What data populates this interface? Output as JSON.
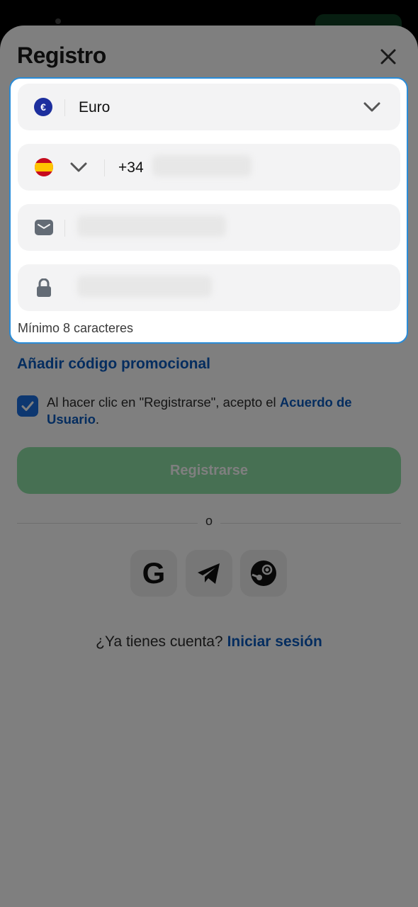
{
  "sheet": {
    "title": "Registro"
  },
  "currency": {
    "symbol": "€",
    "value": "Euro"
  },
  "phone": {
    "code": "+34"
  },
  "password": {
    "hint": "Mínimo 8 caracteres"
  },
  "promo": {
    "label": "Añadir código promocional"
  },
  "agreement": {
    "checked": true,
    "text": "Al hacer clic en \"Registrarse\", acepto el ",
    "link": "Acuerdo de Usuario",
    "suffix": "."
  },
  "register": {
    "label": "Registrarse"
  },
  "divider": {
    "label": "o"
  },
  "social": [
    {
      "name": "google-icon",
      "label": "G"
    },
    {
      "name": "telegram-icon"
    },
    {
      "name": "steam-icon"
    }
  ],
  "login": {
    "prompt": "¿Ya tienes cuenta?",
    "link": "Iniciar sesión"
  },
  "colors": {
    "brand_blue": "#0a5bbf",
    "register_green": "#8fe0a6",
    "checkbox_blue": "#1b6fe0",
    "highlight_border": "#2a8cd8"
  }
}
